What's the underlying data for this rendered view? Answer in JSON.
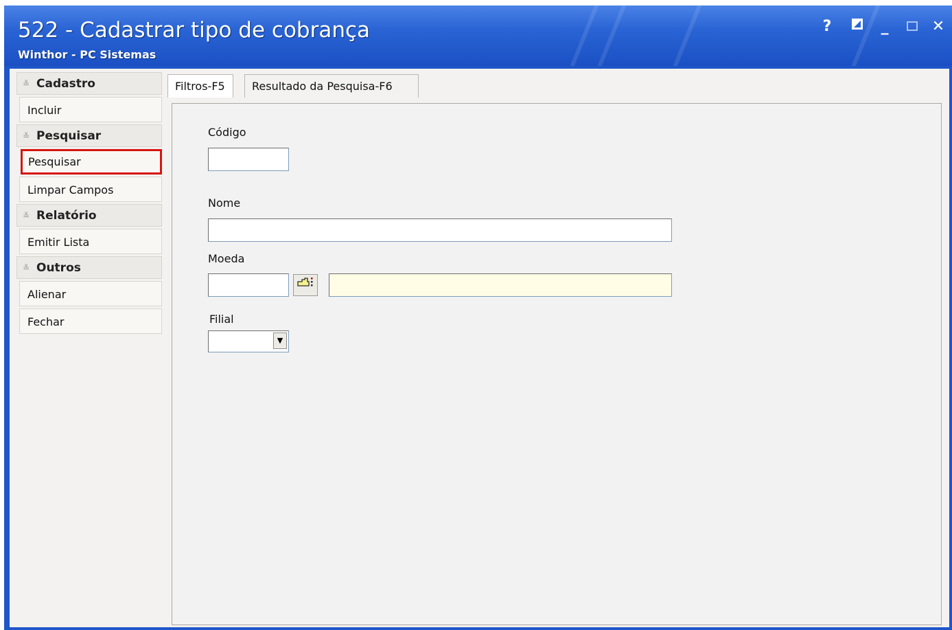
{
  "window": {
    "title": "522 - Cadastrar tipo de cobrança",
    "subtitle": "Winthor - PC Sistemas",
    "controls": {
      "help": "?",
      "restore": "▣",
      "minimize": "_",
      "maximize": "☐",
      "close": "✕"
    }
  },
  "sidebar": {
    "groups": [
      {
        "label": "Cadastro",
        "items": [
          {
            "label": "Incluir"
          }
        ]
      },
      {
        "label": "Pesquisar",
        "items": [
          {
            "label": "Pesquisar",
            "highlighted": true
          },
          {
            "label": "Limpar Campos"
          }
        ]
      },
      {
        "label": "Relatório",
        "items": [
          {
            "label": "Emitir Lista"
          }
        ]
      },
      {
        "label": "Outros",
        "items": [
          {
            "label": "Alienar"
          },
          {
            "label": "Fechar"
          }
        ]
      }
    ],
    "chevron_icon": "double-chevron-down-icon"
  },
  "tabs": [
    {
      "label": "Filtros-F5",
      "active": true
    },
    {
      "label": "Resultado da Pesquisa-F6",
      "active": false
    }
  ],
  "form": {
    "codigo_label": "Código",
    "codigo_value": "",
    "nome_label": "Nome",
    "nome_value": "",
    "moeda_label": "Moeda",
    "moeda_code_value": "",
    "moeda_desc_value": "",
    "lookup_icon": "lookup-hand-icon",
    "filial_label": "Filial",
    "filial_value": ""
  },
  "colors": {
    "title_bar": "#2a64d4",
    "highlight_border": "#d7140f",
    "lookup_field_bg": "#fffde6"
  }
}
